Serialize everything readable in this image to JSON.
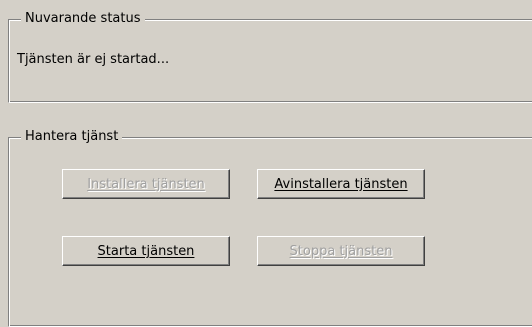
{
  "status_group": {
    "title": "Nuvarande status",
    "status_text": "Tjänsten är ej startad..."
  },
  "manage_group": {
    "title": "Hantera tjänst",
    "buttons": {
      "install": {
        "label": "Installera tjänsten",
        "enabled": false
      },
      "uninstall": {
        "label": "Avinstallera tjänsten",
        "enabled": true
      },
      "start": {
        "label": "Starta tjänsten",
        "enabled": true
      },
      "stop": {
        "label": "Stoppa tjänsten",
        "enabled": false
      }
    }
  },
  "colors": {
    "background": "#d4d0c8",
    "disabled_text": "#a0a0a0"
  }
}
